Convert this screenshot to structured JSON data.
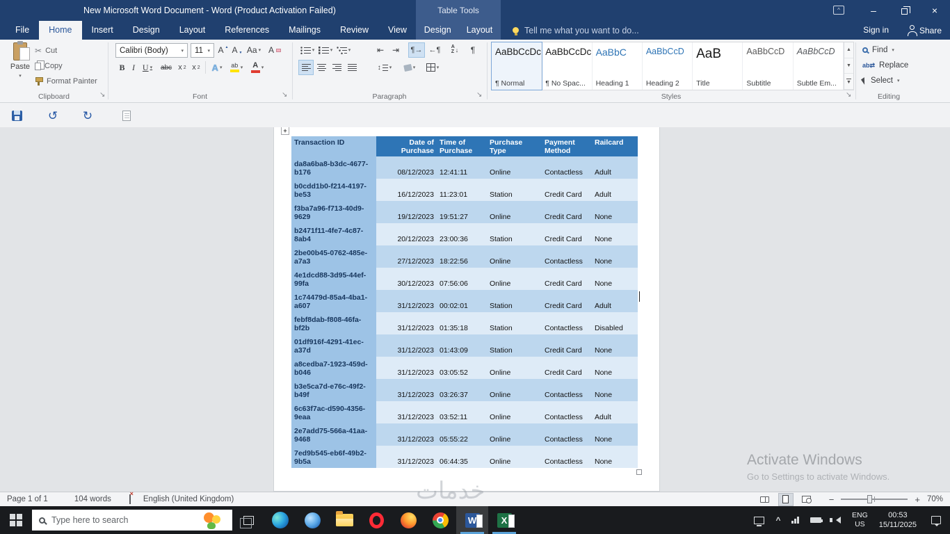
{
  "titlebar": {
    "title": "New Microsoft Word Document - Word (Product Activation Failed)",
    "context_title": "Table Tools"
  },
  "tabs": {
    "items": [
      "File",
      "Home",
      "Insert",
      "Design",
      "Layout",
      "References",
      "Mailings",
      "Review",
      "View"
    ],
    "active": "Home",
    "contextual": [
      "Design",
      "Layout"
    ],
    "tell_me": "Tell me what you want to do...",
    "sign_in": "Sign in",
    "share": "Share"
  },
  "ribbon": {
    "clipboard": {
      "label": "Clipboard",
      "paste": "Paste",
      "cut": "Cut",
      "copy": "Copy",
      "format_painter": "Format Painter"
    },
    "font": {
      "label": "Font",
      "family": "Calibri (Body)",
      "size": "11"
    },
    "paragraph": {
      "label": "Paragraph"
    },
    "styles": {
      "label": "Styles",
      "items": [
        {
          "preview": "AaBbCcDc",
          "name": "¶ Normal"
        },
        {
          "preview": "AaBbCcDc",
          "name": "¶ No Spac..."
        },
        {
          "preview": "AaBbC",
          "name": "Heading 1"
        },
        {
          "preview": "AaBbCcD",
          "name": "Heading 2"
        },
        {
          "preview": "AaB",
          "name": "Title"
        },
        {
          "preview": "AaBbCcD",
          "name": "Subtitle"
        },
        {
          "preview": "AaBbCcD",
          "name": "Subtle Em..."
        }
      ]
    },
    "editing": {
      "label": "Editing",
      "find": "Find",
      "replace": "Replace",
      "select": "Select"
    }
  },
  "document": {
    "table": {
      "headers": [
        "Transaction ID",
        "Date of Purchase",
        "Time of Purchase",
        "Purchase Type",
        "Payment Method",
        "Railcard"
      ],
      "rows": [
        [
          "da8a6ba8-b3dc-4677-b176",
          "08/12/2023",
          "12:41:11",
          "Online",
          "Contactless",
          "Adult"
        ],
        [
          "b0cdd1b0-f214-4197-be53",
          "16/12/2023",
          "11:23:01",
          "Station",
          "Credit Card",
          "Adult"
        ],
        [
          "f3ba7a96-f713-40d9-9629",
          "19/12/2023",
          "19:51:27",
          "Online",
          "Credit Card",
          "None"
        ],
        [
          "b2471f11-4fe7-4c87-8ab4",
          "20/12/2023",
          "23:00:36",
          "Station",
          "Credit Card",
          "None"
        ],
        [
          "2be00b45-0762-485e-a7a3",
          "27/12/2023",
          "18:22:56",
          "Online",
          "Contactless",
          "None"
        ],
        [
          "4e1dcd88-3d95-44ef-99fa",
          "30/12/2023",
          "07:56:06",
          "Online",
          "Credit Card",
          "None"
        ],
        [
          "1c74479d-85a4-4ba1-a607",
          "31/12/2023",
          "00:02:01",
          "Station",
          "Credit Card",
          "Adult"
        ],
        [
          "febf8dab-f808-46fa-bf2b",
          "31/12/2023",
          "01:35:18",
          "Station",
          "Contactless",
          "Disabled"
        ],
        [
          "01df916f-4291-41ec-a37d",
          "31/12/2023",
          "01:43:09",
          "Station",
          "Credit Card",
          "None"
        ],
        [
          "a8cedba7-1923-459d-b046",
          "31/12/2023",
          "03:05:52",
          "Online",
          "Credit Card",
          "None"
        ],
        [
          "b3e5ca7d-e76c-49f2-b49f",
          "31/12/2023",
          "03:26:37",
          "Online",
          "Contactless",
          "None"
        ],
        [
          "6c63f7ac-d590-4356-9eaa",
          "31/12/2023",
          "03:52:11",
          "Online",
          "Contactless",
          "Adult"
        ],
        [
          "2e7add75-566a-41aa-9468",
          "31/12/2023",
          "05:55:22",
          "Online",
          "Contactless",
          "None"
        ],
        [
          "7ed9b545-eb6f-49b2-9b5a",
          "31/12/2023",
          "06:44:35",
          "Online",
          "Contactless",
          "None"
        ]
      ]
    }
  },
  "watermarks": {
    "activate_line1": "Activate Windows",
    "activate_line2": "Go to Settings to activate Windows.",
    "site": "خدمات"
  },
  "statusbar": {
    "page": "Page 1 of 1",
    "words": "104 words",
    "language": "English (United Kingdom)",
    "zoom": "70%"
  },
  "taskbar": {
    "search_placeholder": "Type here to search",
    "word_letter": "W",
    "excel_letter": "X",
    "lang_top": "ENG",
    "lang_bottom": "US",
    "time": "00:53",
    "date": "15/11/2025"
  },
  "colors": {
    "title_bar": "#20406f",
    "context_tools": "#3d5c8c",
    "accent_blue": "#2b579a",
    "table_header_bg": "#2e75b6",
    "table_first_col_bg": "#9dc3e6",
    "band_dark": "#bdd7ee",
    "band_light": "#deebf7",
    "first_col_text": "#17365d"
  }
}
